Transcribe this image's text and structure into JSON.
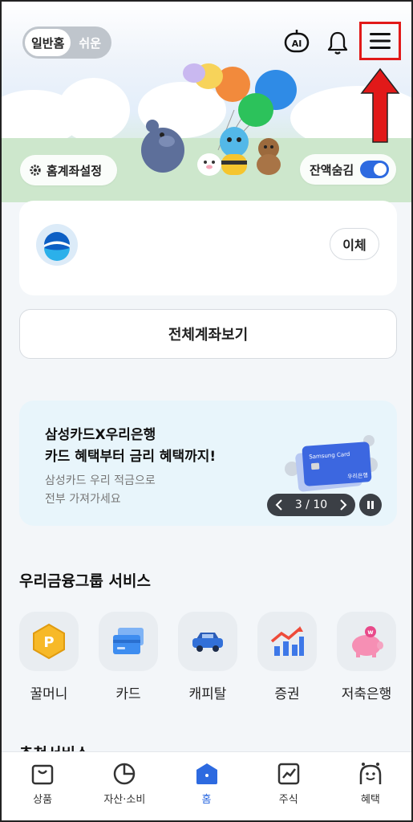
{
  "header": {
    "mode_toggle": {
      "active": "일반홈",
      "inactive": "쉬운"
    },
    "icons": [
      "ai-bot-icon",
      "bell-icon",
      "menu-icon"
    ],
    "ai_label": "AI"
  },
  "hero": {
    "home_account_settings": "홈계좌설정",
    "hide_balance_label": "잔액숨김",
    "hide_balance_on": true
  },
  "account_card": {
    "transfer_label": "이체"
  },
  "view_all_accounts": "전체계좌보기",
  "promo": {
    "headline_1": "삼성카드X우리은행",
    "headline_2": "카드 혜택부터 금리 혜택까지!",
    "sub_1": "삼성카드 우리 적금으로",
    "sub_2": "전부 가져가세요",
    "card_brand": "Samsung Card",
    "card_bank": "우리은행",
    "page_current": "3",
    "page_total": "10",
    "page_text": "3 / 10"
  },
  "group_services": {
    "title": "우리금융그룹 서비스",
    "items": [
      {
        "label": "꿀머니",
        "icon": "honey-money-icon"
      },
      {
        "label": "카드",
        "icon": "cards-icon"
      },
      {
        "label": "캐피탈",
        "icon": "car-icon"
      },
      {
        "label": "증권",
        "icon": "stock-chart-icon"
      },
      {
        "label": "저축은행",
        "icon": "piggy-bank-icon"
      }
    ]
  },
  "next_section_title": "추천서비스",
  "tabbar": {
    "items": [
      {
        "label": "상품",
        "icon": "shopping-bag-icon"
      },
      {
        "label": "자산·소비",
        "icon": "pie-chart-icon"
      },
      {
        "label": "홈",
        "icon": "home-icon",
        "active": true
      },
      {
        "label": "주식",
        "icon": "line-chart-icon"
      },
      {
        "label": "혜택",
        "icon": "smile-bot-icon"
      }
    ]
  },
  "colors": {
    "accent_blue": "#2d6ae0",
    "highlight_red": "#e11919"
  }
}
